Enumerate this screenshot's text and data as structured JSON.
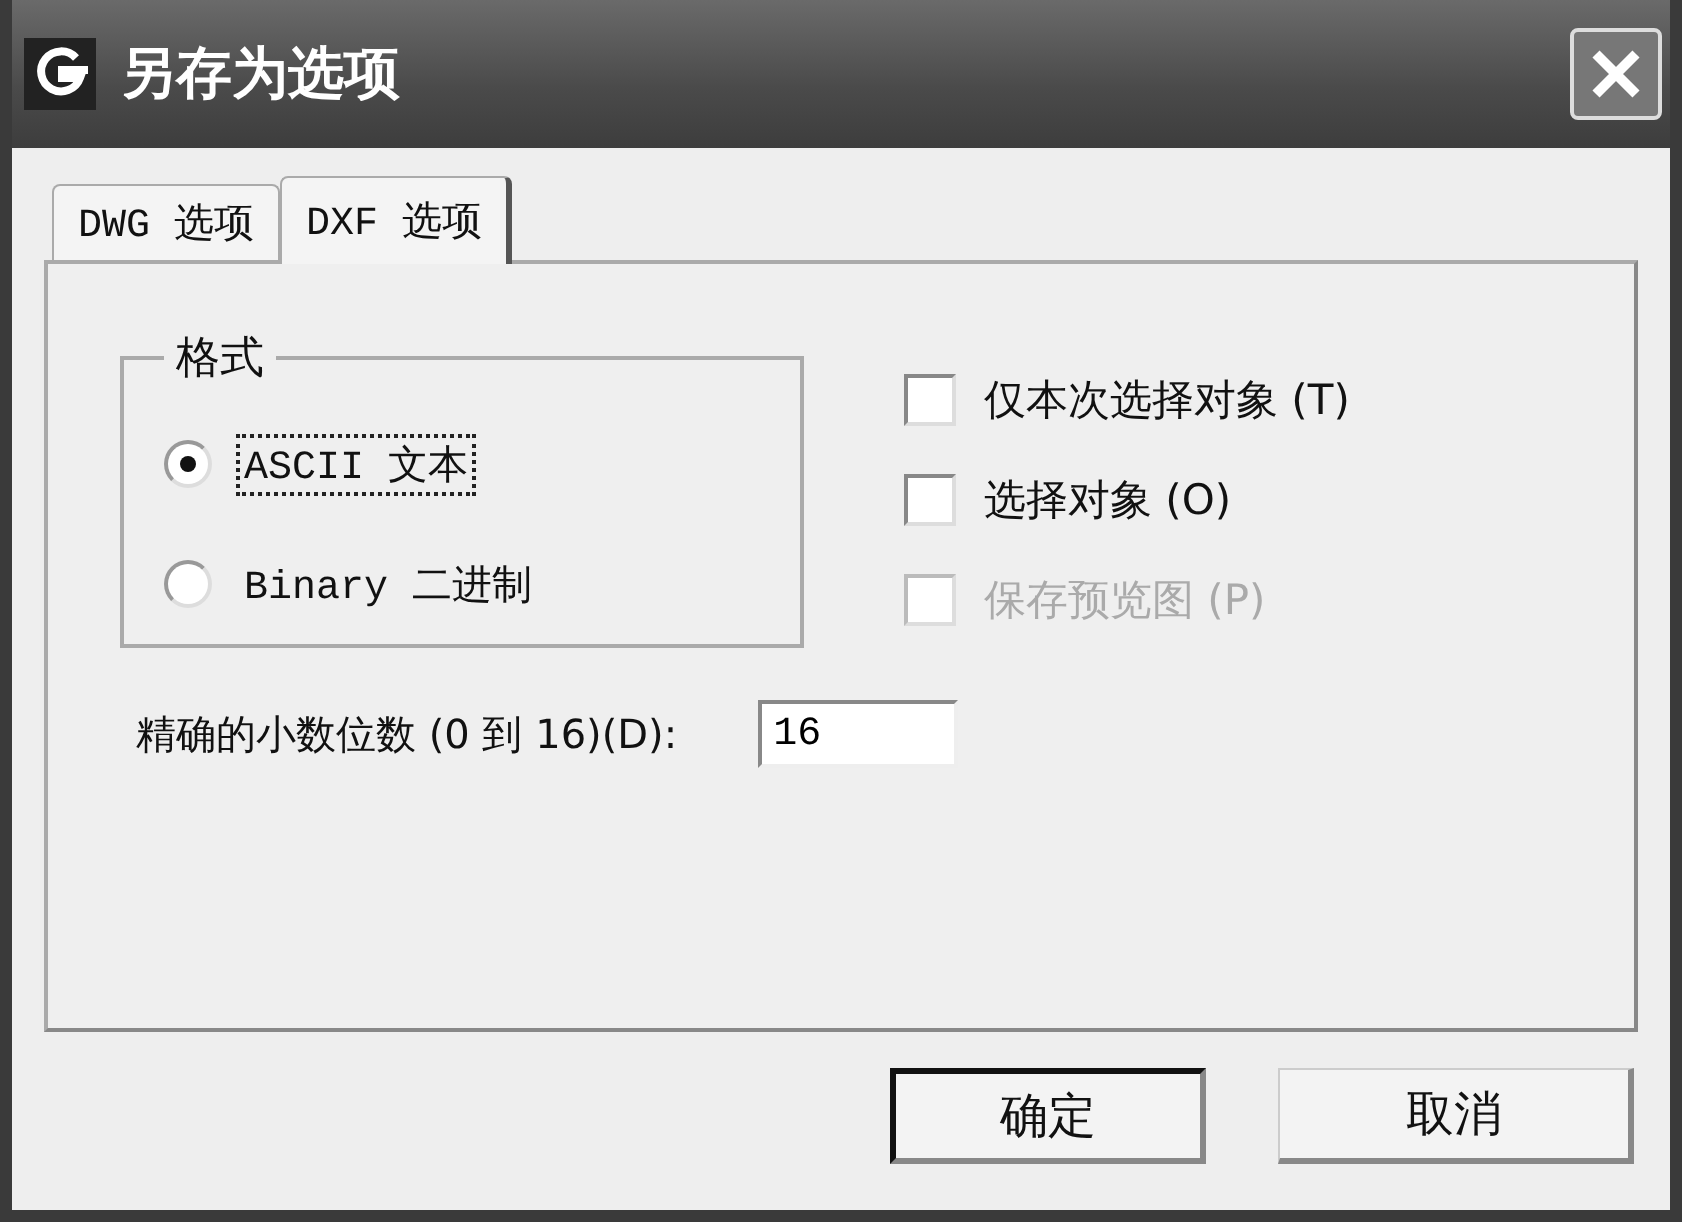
{
  "window": {
    "title": "另存为选项"
  },
  "tabs": [
    {
      "label": "DWG 选项",
      "selected": false
    },
    {
      "label": "DXF 选项",
      "selected": true
    }
  ],
  "format_group": {
    "title": "格式",
    "options": [
      {
        "label": "ASCII 文本",
        "selected": true,
        "focused": true
      },
      {
        "label": "Binary 二进制",
        "selected": false,
        "focused": false
      }
    ]
  },
  "checkboxes": [
    {
      "label": "仅本次选择对象 (T)",
      "checked": false,
      "disabled": false
    },
    {
      "label": "选择对象 (O)",
      "checked": false,
      "disabled": false
    },
    {
      "label": "保存预览图 (P)",
      "checked": false,
      "disabled": true
    }
  ],
  "precision": {
    "label": "精确的小数位数 (0 到 16)(D):",
    "value": "16"
  },
  "buttons": [
    {
      "label": "确定",
      "default": true
    },
    {
      "label": "取消",
      "default": false
    }
  ]
}
